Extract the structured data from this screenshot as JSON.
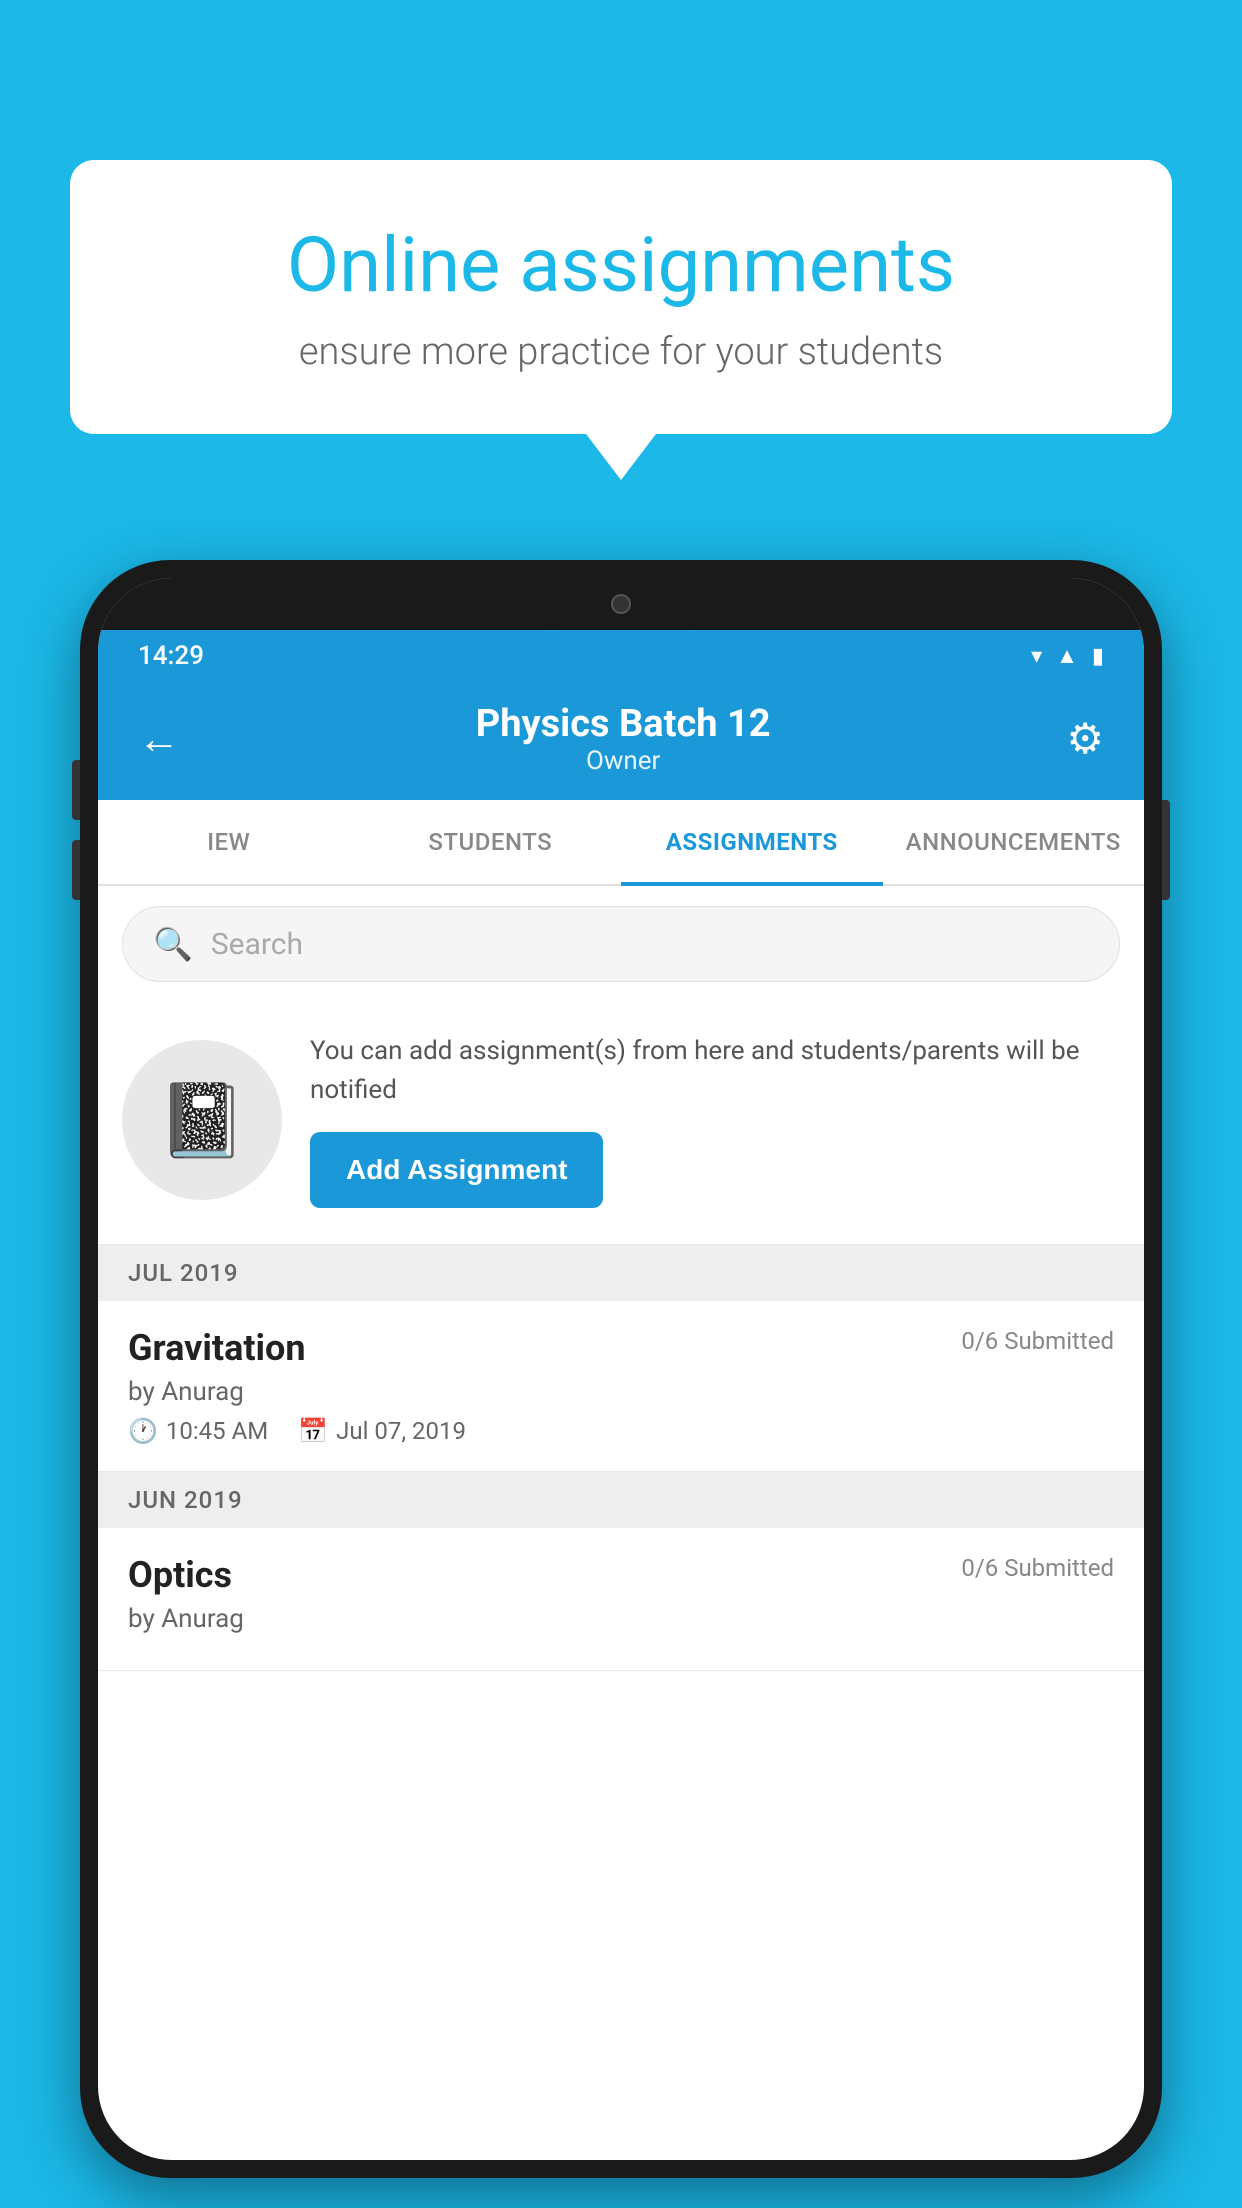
{
  "background_color": "#1BB8E8",
  "speech_bubble": {
    "title": "Online assignments",
    "subtitle": "ensure more practice for your students"
  },
  "status_bar": {
    "time": "14:29",
    "icons": [
      "wifi",
      "signal",
      "battery"
    ]
  },
  "app_header": {
    "title": "Physics Batch 12",
    "subtitle": "Owner",
    "back_label": "←",
    "gear_label": "⚙"
  },
  "tabs": [
    {
      "label": "IEW",
      "active": false
    },
    {
      "label": "STUDENTS",
      "active": false
    },
    {
      "label": "ASSIGNMENTS",
      "active": true
    },
    {
      "label": "ANNOUNCEMENTS",
      "active": false
    }
  ],
  "search": {
    "placeholder": "Search"
  },
  "promo": {
    "description": "You can add assignment(s) from here and students/parents will be notified",
    "button_label": "Add Assignment"
  },
  "assignments": [
    {
      "month_label": "JUL 2019",
      "name": "Gravitation",
      "submitted": "0/6 Submitted",
      "author": "by Anurag",
      "time": "10:45 AM",
      "date": "Jul 07, 2019"
    },
    {
      "month_label": "JUN 2019",
      "name": "Optics",
      "submitted": "0/6 Submitted",
      "author": "by Anurag",
      "time": "",
      "date": ""
    }
  ]
}
